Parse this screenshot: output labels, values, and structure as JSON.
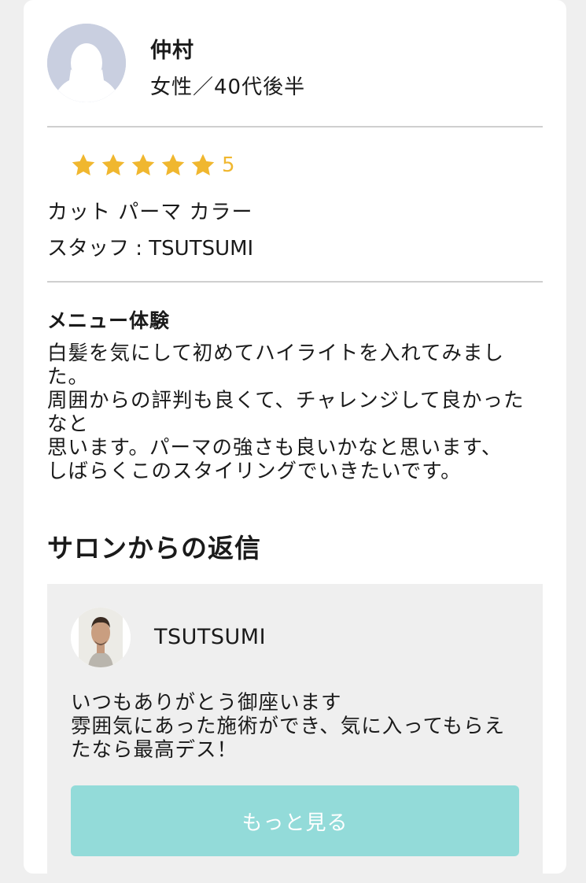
{
  "reviewer": {
    "name": "仲村",
    "meta": "女性／40代後半"
  },
  "rating": {
    "stars": 5,
    "max_stars": 5,
    "value_label": "5",
    "star_color": "#f0b72f"
  },
  "review": {
    "menus": "カット パーマ カラー",
    "staff_line": "スタッフ : TSUTSUMI",
    "section_label": "メニュー体験",
    "body": "白髪を気にして初めてハイライトを入れてみました。\n周囲からの評判も良くて、チャレンジして良かったなと\n思います。パーマの強さも良いかなと思います、\nしばらくこのスタイリングでいきたいです。"
  },
  "reply": {
    "heading": "サロンからの返信",
    "staff_name": "TSUTSUMI",
    "body": "いつもありがとう御座います\n雰囲気にあった施術ができ、気に入ってもらえたなら最高デス！",
    "more_button": "もっと見る",
    "button_color": "#93dbd9"
  },
  "icons": {
    "reviewer_avatar": "default-female-avatar-icon",
    "star": "star-icon",
    "staff_avatar": "staff-photo"
  }
}
